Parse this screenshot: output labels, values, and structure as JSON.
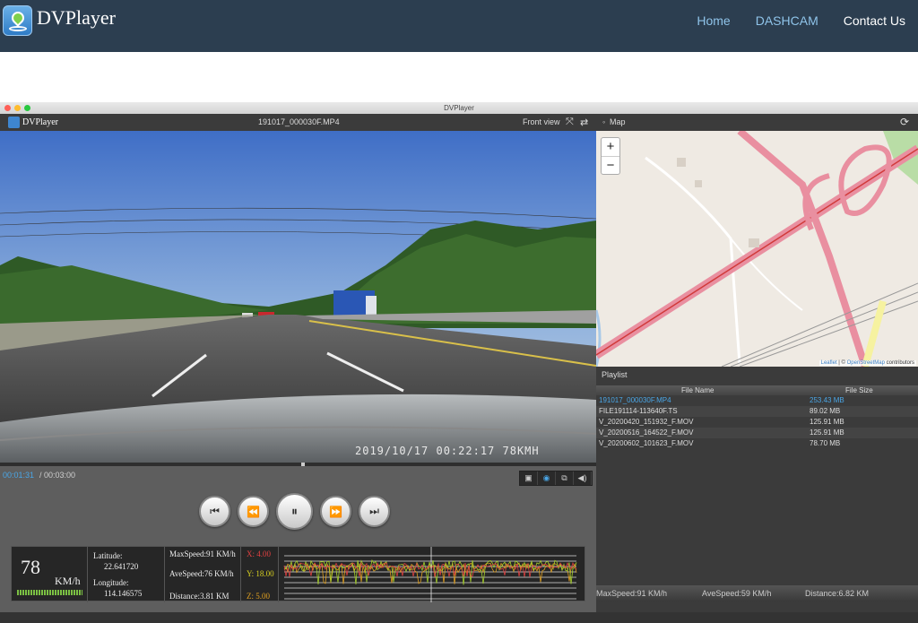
{
  "site": {
    "title": "DVPlayer",
    "nav": [
      "Home",
      "DASHCAM",
      "Contact Us"
    ]
  },
  "window": {
    "title": "DVPlayer"
  },
  "app": {
    "name": "DVPlayer",
    "file_name": "191017_000030F.MP4",
    "view_label": "Front view",
    "map_label": "Map"
  },
  "video": {
    "osd": "2019/10/17  00:22:17  78KMH"
  },
  "player": {
    "current_time": "00:01:31",
    "total_time": "/ 00:03:00",
    "progress_fraction": 0.505
  },
  "telemetry": {
    "speed_value": "78",
    "speed_unit": "KM/h",
    "latitude_label": "Latitude:",
    "latitude_value": "22.641720",
    "longitude_label": "Longitude:",
    "longitude_value": "114.146575",
    "max_speed": "MaxSpeed:91 KM/h",
    "ave_speed": "AveSpeed:76 KM/h",
    "distance": "Distance:3.81 KM",
    "x": "X: 4.00",
    "y": "Y: 18.00",
    "z": "Z: 5.00"
  },
  "map": {
    "zoom_in": "+",
    "zoom_out": "−",
    "attribution_link1": "Leaflet",
    "attribution_sep": " | © ",
    "attribution_link2": "OpenStreetMap",
    "attribution_tail": " contributors"
  },
  "playlist": {
    "title": "Playlist",
    "col_name": "File Name",
    "col_size": "File Size",
    "rows": [
      {
        "name": "191017_000030F.MP4",
        "size": "253.43 MB",
        "selected": true
      },
      {
        "name": "FILE191114-113640F.TS",
        "size": "89.02 MB",
        "selected": false
      },
      {
        "name": "V_20200420_151932_F.MOV",
        "size": "125.91 MB",
        "selected": false
      },
      {
        "name": "V_20200516_164522_F.MOV",
        "size": "125.91 MB",
        "selected": false
      },
      {
        "name": "V_20200602_101623_F.MOV",
        "size": "78.70 MB",
        "selected": false
      }
    ]
  },
  "summary": {
    "max_speed": "MaxSpeed:91 KM/h",
    "ave_speed": "AveSpeed:59 KM/h",
    "distance": "Distance:6.82 KM"
  },
  "colors": {
    "header_bg": "#2c3e50",
    "nav_link": "#8fc4ea",
    "accent_blue": "#4aa6e6",
    "axis_x": "#e04040",
    "axis_y": "#d8d020",
    "axis_z": "#e0a020"
  }
}
